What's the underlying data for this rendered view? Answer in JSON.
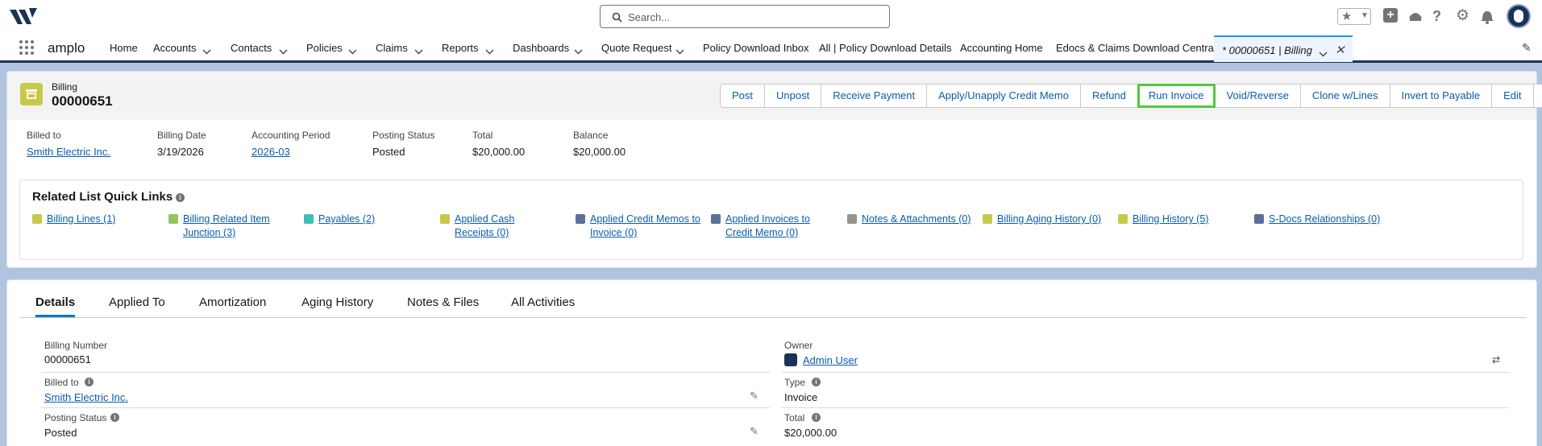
{
  "search": {
    "placeholder": "Search..."
  },
  "app": {
    "name": "amplo"
  },
  "nav": {
    "items": [
      "Home",
      "Accounts",
      "Contacts",
      "Policies",
      "Claims",
      "Reports",
      "Dashboards",
      "Quote Request",
      "Policy Download Inbox",
      "All | Policy Download Details",
      "Accounting Home",
      "Edocs & Claims Download Central"
    ],
    "active_tab": "* 00000651 | Billing"
  },
  "record": {
    "object_label": "Billing",
    "name": "00000651",
    "buttons": [
      "Post",
      "Unpost",
      "Receive Payment",
      "Apply/Unapply Credit Memo",
      "Refund",
      "Run Invoice",
      "Void/Reverse",
      "Clone w/Lines",
      "Invert to Payable",
      "Edit"
    ],
    "highlight_button": "Run Invoice"
  },
  "highlights": {
    "billed_to_label": "Billed to",
    "billed_to": "Smith Electric Inc.",
    "billing_date_label": "Billing Date",
    "billing_date": "3/19/2026",
    "period_label": "Accounting Period",
    "period": "2026-03",
    "posting_label": "Posting Status",
    "posting": "Posted",
    "total_label": "Total",
    "total": "$20,000.00",
    "balance_label": "Balance",
    "balance": "$20,000.00"
  },
  "related": {
    "title": "Related List Quick Links",
    "links": [
      {
        "l1": "Billing Lines (1)",
        "l2": "",
        "color": "#c7c94a"
      },
      {
        "l1": "Billing Related Item",
        "l2": "Junction (3)",
        "color": "#8fc75d"
      },
      {
        "l1": "Payables (2)",
        "l2": "",
        "color": "#3bc2b5"
      },
      {
        "l1": "Applied Cash",
        "l2": "Receipts (0)",
        "color": "#c7c94a"
      },
      {
        "l1": "Applied Credit Memos to",
        "l2": "Invoice (0)",
        "color": "#5a7099"
      },
      {
        "l1": "Applied Invoices to",
        "l2": "Credit Memo (0)",
        "color": "#5a7099"
      },
      {
        "l1": "Notes & Attachments (0)",
        "l2": "",
        "color": "#939393"
      },
      {
        "l1": "Billing Aging History (0)",
        "l2": "",
        "color": "#c7c94a"
      },
      {
        "l1": "Billing History (5)",
        "l2": "",
        "color": "#c7c94a"
      },
      {
        "l1": "S-Docs Relationships (0)",
        "l2": "",
        "color": "#5a7099"
      }
    ]
  },
  "tabs": [
    "Details",
    "Applied To",
    "Amortization",
    "Aging History",
    "Notes & Files",
    "All Activities"
  ],
  "details": {
    "billing_number_label": "Billing Number",
    "billing_number": "00000651",
    "billed_to_label": "Billed to",
    "billed_to": "Smith Electric Inc.",
    "posting_label": "Posting Status",
    "posting": "Posted",
    "owner_label": "Owner",
    "owner": "Admin User",
    "type_label": "Type",
    "type": "Invoice",
    "total_label": "Total",
    "total": "$20,000.00"
  }
}
